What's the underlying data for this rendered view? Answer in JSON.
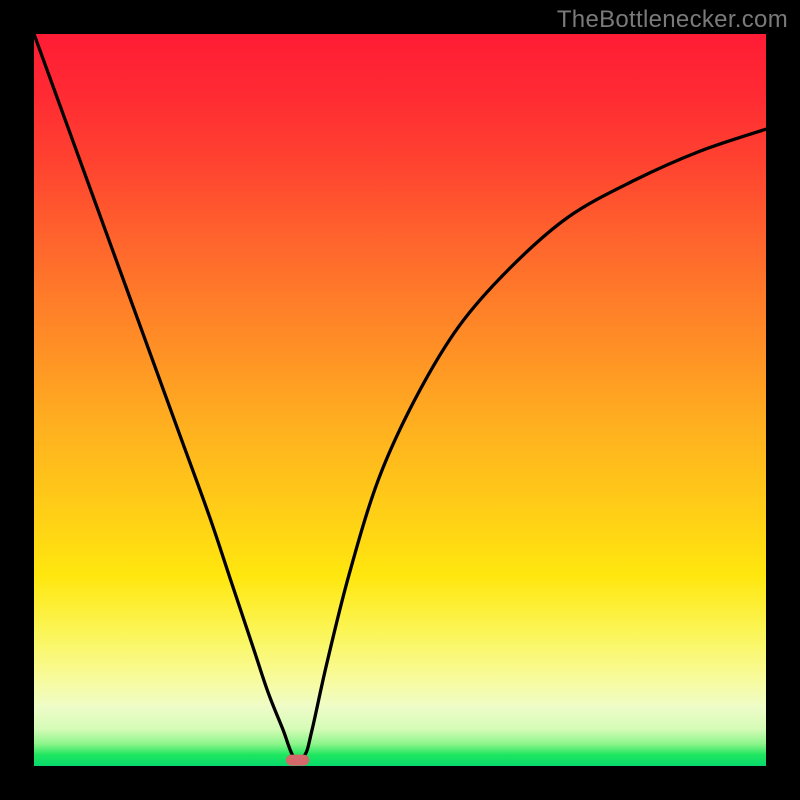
{
  "attribution": "TheBottlenecker.com",
  "colors": {
    "page_bg": "#000000",
    "curve": "#000000",
    "marker": "#d4686a",
    "attribution_text": "#7a7a7a",
    "gradient_top": "#ff1c35",
    "gradient_bottom": "#07d96b"
  },
  "chart_data": {
    "type": "line",
    "title": "",
    "xlabel": "",
    "ylabel": "",
    "xlim": [
      0,
      100
    ],
    "ylim": [
      0,
      100
    ],
    "grid": false,
    "legend": null,
    "series": [
      {
        "name": "bottleneck-curve",
        "x": [
          0,
          4,
          8,
          12,
          16,
          20,
          24,
          27,
          30,
          32,
          34,
          35.5,
          37,
          38,
          40,
          43,
          47,
          52,
          58,
          65,
          73,
          82,
          91,
          100
        ],
        "y": [
          100,
          89,
          78,
          67,
          56,
          45,
          34,
          25,
          16,
          10,
          5,
          1.2,
          1.5,
          5,
          14,
          26,
          39,
          50,
          60,
          68,
          75,
          80,
          84,
          87
        ]
      }
    ],
    "annotations": [
      {
        "name": "min-marker",
        "x": 36,
        "y": 0.8,
        "shape": "rounded-rect"
      }
    ],
    "background_scale": {
      "orientation": "vertical",
      "meaning": "red=high bottleneck, green=low bottleneck"
    }
  }
}
